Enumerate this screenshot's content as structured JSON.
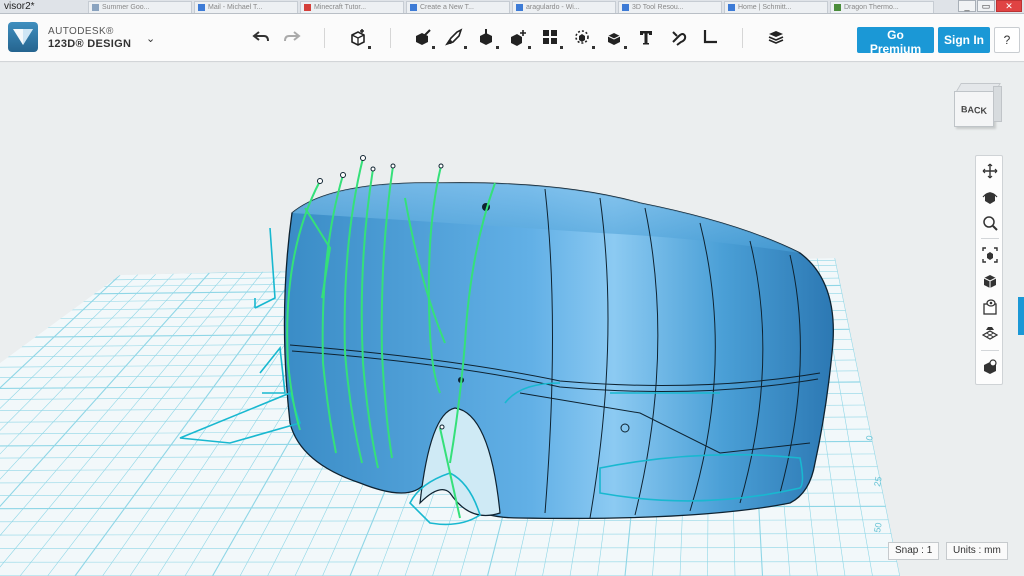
{
  "window": {
    "title": "visor2*",
    "browser_tabs": [
      {
        "label": "Summer Goo...",
        "color": "#8aa3bf"
      },
      {
        "label": "Mail - Michael T...",
        "color": "#3d7bd6"
      },
      {
        "label": "Minecraft Tutor...",
        "color": "#d43f3a"
      },
      {
        "label": "Create a New T...",
        "color": "#3d7bd6"
      },
      {
        "label": "aragulardo - Wi...",
        "color": "#3d7bd6"
      },
      {
        "label": "3D Tool Resou...",
        "color": "#3d7bd6"
      },
      {
        "label": "Home | Schmitt...",
        "color": "#3d7bd6"
      },
      {
        "label": "Dragon Thermo...",
        "color": "#4a8c3a"
      }
    ],
    "controls": [
      "_",
      "▭",
      "✕"
    ]
  },
  "app": {
    "brand_line1": "AUTODESK®",
    "brand_line2": "123D® DESIGN",
    "menu_chevron": "⌄",
    "toolbar_icons": [
      "undo-icon",
      "redo-icon",
      "primitives-icon",
      "sketch-icon",
      "construct-icon",
      "modify-icon",
      "pattern-icon",
      "grouping-icon",
      "combine-icon",
      "text-icon",
      "snap-icon",
      "measure-icon",
      "material-icon"
    ],
    "go_premium": "Go Premium",
    "sign_in": "Sign In",
    "help": "?"
  },
  "viewcube": {
    "label": "BACK"
  },
  "nav_tools": [
    "pan-icon",
    "orbit-icon",
    "zoom-icon",
    "fit-icon",
    "views-icon",
    "visibility-icon",
    "grid-settings-icon",
    "material-render-icon"
  ],
  "status": {
    "snap": "Snap : 1",
    "units": "Units : mm"
  },
  "grid": {
    "labels": [
      "0",
      "25",
      "50"
    ]
  },
  "colors": {
    "accent": "#1b98d6",
    "model_body": "#4a9fd6",
    "sketch_curves": "#35e07a",
    "grid_line": "#6ecfe0",
    "background": "#ebeeef"
  }
}
